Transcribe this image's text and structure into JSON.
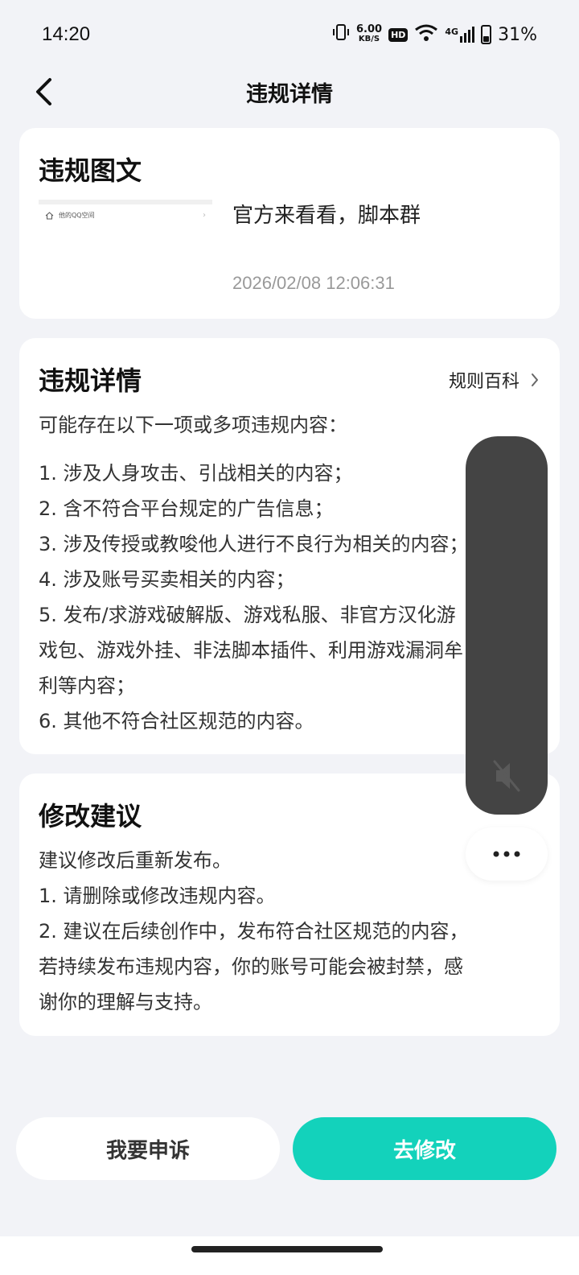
{
  "status_bar": {
    "time": "14:20",
    "net_speed_value": "6.00",
    "net_speed_unit": "KB/S",
    "hd_label": "HD",
    "network_label": "4G",
    "battery_percent": "31%"
  },
  "nav": {
    "title": "违规详情",
    "back_icon": "chevron-left-icon"
  },
  "violation_post": {
    "section_title": "违规图文",
    "thumbnail_text": "他的QQ空间",
    "post_text": "官方来看看，脚本群",
    "timestamp": "2026/02/08 12:06:31"
  },
  "violation_details": {
    "section_title": "违规详情",
    "rules_link": "规则百科",
    "intro": "可能存在以下一项或多项违规内容：",
    "lines": [
      "1. 涉及人身攻击、引战相关的内容；",
      "2. 含不符合平台规定的广告信息；",
      "3. 涉及传授或教唆他人进行不良行为相关的内容；",
      "4. 涉及账号买卖相关的内容；",
      "5. 发布/求游戏破解版、游戏私服、非官方汉化游",
      "戏包、游戏外挂、非法脚本插件、利用游戏漏洞牟",
      "利等内容；",
      "6. 其他不符合社区规范的内容。"
    ]
  },
  "suggestions": {
    "section_title": "修改建议",
    "lines": [
      "建议修改后重新发布。",
      "1. 请删除或修改违规内容。",
      "2. 建议在后续创作中，发布符合社区规范的内容，",
      "若持续发布违规内容，你的账号可能会被封禁，感",
      "谢你的理解与支持。"
    ]
  },
  "floating_panel": {
    "mute_icon": "volume-mute-icon",
    "more_icon": "more-dots-icon"
  },
  "actions": {
    "appeal_label": "我要申诉",
    "edit_label": "去修改"
  },
  "colors": {
    "accent": "#13d2bb",
    "background": "#f2f3f7",
    "panel": "#444444"
  }
}
